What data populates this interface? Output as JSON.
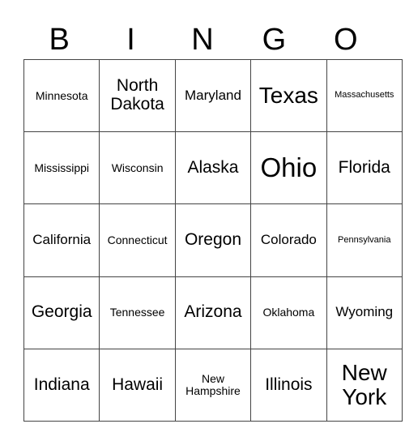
{
  "header": [
    "B",
    "I",
    "N",
    "G",
    "O"
  ],
  "grid": [
    [
      {
        "text": "Minnesota",
        "size": "s2"
      },
      {
        "text": "North Dakota",
        "size": "s4"
      },
      {
        "text": "Maryland",
        "size": "s3"
      },
      {
        "text": "Texas",
        "size": "s5"
      },
      {
        "text": "Massachusetts",
        "size": "s1"
      }
    ],
    [
      {
        "text": "Mississippi",
        "size": "s2"
      },
      {
        "text": "Wisconsin",
        "size": "s2"
      },
      {
        "text": "Alaska",
        "size": "s4"
      },
      {
        "text": "Ohio",
        "size": "s6"
      },
      {
        "text": "Florida",
        "size": "s4"
      }
    ],
    [
      {
        "text": "California",
        "size": "s3"
      },
      {
        "text": "Connecticut",
        "size": "s2"
      },
      {
        "text": "Oregon",
        "size": "s4"
      },
      {
        "text": "Colorado",
        "size": "s3"
      },
      {
        "text": "Pennsylvania",
        "size": "s1"
      }
    ],
    [
      {
        "text": "Georgia",
        "size": "s4"
      },
      {
        "text": "Tennessee",
        "size": "s2"
      },
      {
        "text": "Arizona",
        "size": "s4"
      },
      {
        "text": "Oklahoma",
        "size": "s2"
      },
      {
        "text": "Wyoming",
        "size": "s3"
      }
    ],
    [
      {
        "text": "Indiana",
        "size": "s4"
      },
      {
        "text": "Hawaii",
        "size": "s4"
      },
      {
        "text": "New Hampshire",
        "size": "s2"
      },
      {
        "text": "Illinois",
        "size": "s4"
      },
      {
        "text": "New York",
        "size": "s5"
      }
    ]
  ]
}
